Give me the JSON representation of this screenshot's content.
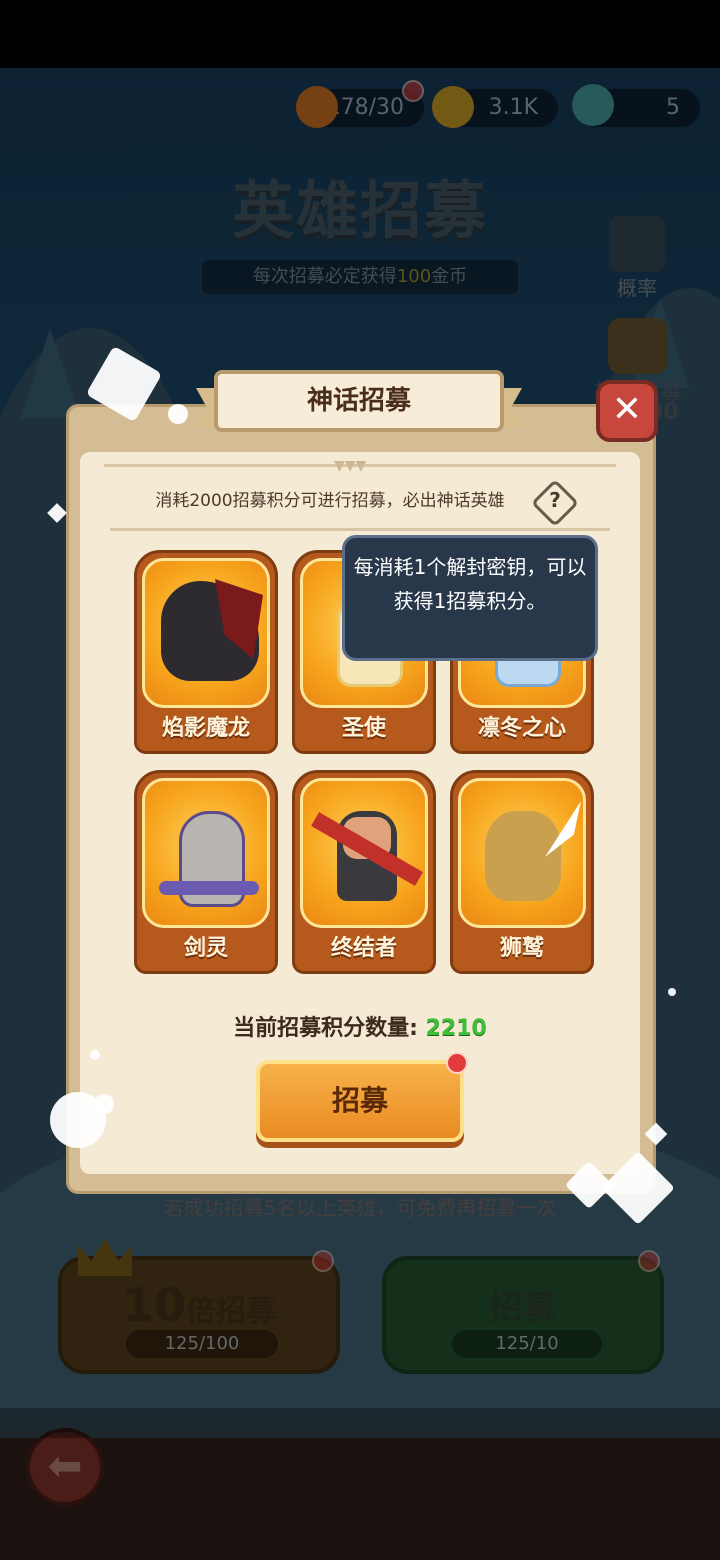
{
  "resources": {
    "stamina": "178/30",
    "gold": "3.1K",
    "gems": "5"
  },
  "background": {
    "title": "英雄招募",
    "subtitle_prefix": "每次招募必定获得",
    "subtitle_amount": "100",
    "subtitle_suffix": "金币",
    "odds_label": "概率",
    "mythic_label": "神话招募",
    "mythic_count_fragment": "00",
    "bonus_notice": "若成功招募5名以上英雄，可免费再招募一次",
    "ten_recruit_number": "10",
    "ten_recruit_label": "倍招募",
    "ten_recruit_cost": "125/100",
    "single_recruit_label": "招募",
    "single_recruit_cost": "125/10"
  },
  "modal": {
    "title": "神话招募",
    "description": "消耗2000招募积分可进行招募，必出神话英雄",
    "help_symbol": "?",
    "heroes": [
      {
        "name": "焰影魔龙"
      },
      {
        "name": "圣使"
      },
      {
        "name": "凛冬之心"
      },
      {
        "name": "剑灵"
      },
      {
        "name": "终结者"
      },
      {
        "name": "狮鹫"
      }
    ],
    "tooltip_text": "每消耗1个解封密钥，可以获得1招募积分。",
    "points_label": "当前招募积分数量:",
    "points_value": "2210",
    "recruit_button": "招募",
    "close_symbol": "✕"
  },
  "colors": {
    "accent_orange": "#f09a2a",
    "points_green": "#3fbe3a",
    "close_red": "#c8473c"
  }
}
